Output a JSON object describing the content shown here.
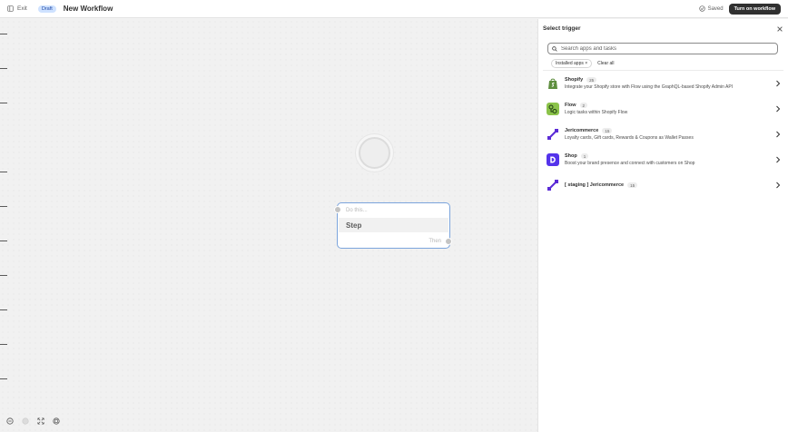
{
  "header": {
    "exit_label": "Exit",
    "status_badge": "Draft",
    "title": "New Workflow",
    "saved_label": "Saved",
    "turn_on_label": "Turn on workflow"
  },
  "canvas": {
    "step": {
      "do_label": "Do this...",
      "label": "Step",
      "then_label": "Then"
    }
  },
  "panel": {
    "title": "Select trigger",
    "search_placeholder": "Search apps and tasks",
    "filter_chip": "Installed apps ×",
    "clear_all": "Clear all",
    "apps": [
      {
        "name": "Shopify",
        "count": "25",
        "description": "Integrate your Shopify store with Flow using the GraphQL-based Shopify Admin API",
        "icon": "shopify-bag-icon"
      },
      {
        "name": "Flow",
        "count": "2",
        "description": "Logic tasks within Shopify Flow",
        "icon": "flow-icon"
      },
      {
        "name": "Jericommerce",
        "count": "15",
        "description": "Loyalty cards, Gift cards, Rewards & Coupons as Wallet Passes",
        "icon": "jericommerce-icon"
      },
      {
        "name": "Shop",
        "count": "1",
        "description": "Boost your brand presence and connect with customers on Shop",
        "icon": "shop-icon"
      },
      {
        "name": "[ staging ] Jericommerce",
        "count": "15",
        "description": "",
        "icon": "jericommerce-icon"
      }
    ]
  },
  "colors": {
    "accent_blue": "#7ba4dc",
    "draft_badge_bg": "#cfe2ff",
    "shopify_green": "#5e8e3e",
    "flow_green": "#8bc34a",
    "jericommerce_purple": "#5b2bd6",
    "shop_purple": "#5433eb"
  }
}
